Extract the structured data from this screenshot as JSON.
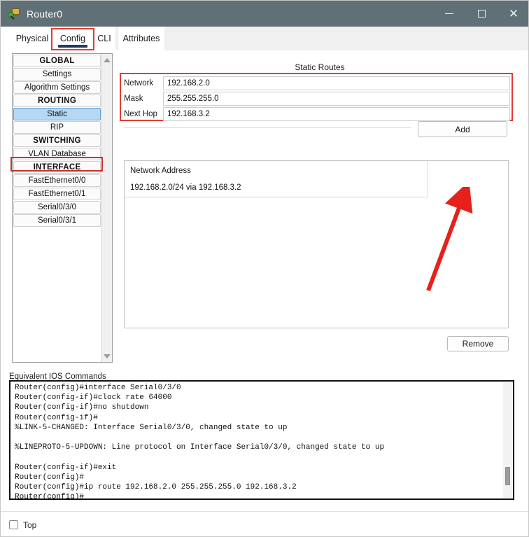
{
  "window": {
    "title": "Router0",
    "app_icon": "router-magnifier-icon",
    "controls": {
      "minimize": "minimize-icon",
      "maximize": "maximize-icon",
      "close": "close-icon"
    },
    "titlebar_color": "#5f7077"
  },
  "tabs": [
    {
      "id": "physical",
      "label": "Physical",
      "active": false
    },
    {
      "id": "config",
      "label": "Config",
      "active": true
    },
    {
      "id": "cli",
      "label": "CLI",
      "active": false
    },
    {
      "id": "attributes",
      "label": "Attributes",
      "active": false
    }
  ],
  "sidebar": {
    "items": [
      {
        "label": "GLOBAL",
        "type": "header",
        "selected": false
      },
      {
        "label": "Settings",
        "type": "item",
        "selected": false
      },
      {
        "label": "Algorithm Settings",
        "type": "item",
        "selected": false
      },
      {
        "label": "ROUTING",
        "type": "header",
        "selected": false
      },
      {
        "label": "Static",
        "type": "item",
        "selected": true
      },
      {
        "label": "RIP",
        "type": "item",
        "selected": false
      },
      {
        "label": "SWITCHING",
        "type": "header",
        "selected": false
      },
      {
        "label": "VLAN Database",
        "type": "item",
        "selected": false
      },
      {
        "label": "INTERFACE",
        "type": "header",
        "selected": false
      },
      {
        "label": "FastEthernet0/0",
        "type": "item",
        "selected": false
      },
      {
        "label": "FastEthernet0/1",
        "type": "item",
        "selected": false
      },
      {
        "label": "Serial0/3/0",
        "type": "item",
        "selected": false
      },
      {
        "label": "Serial0/3/1",
        "type": "item",
        "selected": false
      }
    ],
    "scroll_up_icon": "scroll-up-arrow-icon",
    "scroll_down_icon": "scroll-down-arrow-icon"
  },
  "static_routes": {
    "section_title": "Static Routes",
    "fields": {
      "network_label": "Network",
      "network_value": "192.168.2.0",
      "mask_label": "Mask",
      "mask_value": "255.255.255.0",
      "next_hop_label": "Next Hop",
      "next_hop_value": "192.168.3.2"
    },
    "add_label": "Add",
    "remove_label": "Remove",
    "list": {
      "column_header": "Network Address",
      "rows": [
        "192.168.2.0/24 via 192.168.3.2"
      ]
    }
  },
  "annotations": {
    "highlight_color": "#e23b35",
    "arrow_color": "#e8201a",
    "boxes": [
      "config-tab",
      "static-sidebar-item",
      "static-route-fields"
    ],
    "arrow_target": "Add"
  },
  "ios": {
    "label": "Equivalent IOS Commands",
    "text": "Router(config)#interface Serial0/3/0\nRouter(config-if)#clock rate 64000\nRouter(config-if)#no shutdown\nRouter(config-if)#\n%LINK-5-CHANGED: Interface Serial0/3/0, changed state to up\n\n%LINEPROTO-5-UPDOWN: Line protocol on Interface Serial0/3/0, changed state to up\n\nRouter(config-if)#exit\nRouter(config)#\nRouter(config)#ip route 192.168.2.0 255.255.255.0 192.168.3.2\nRouter(config)#"
  },
  "bottom": {
    "top_checkbox_label": "Top",
    "top_checked": false
  }
}
